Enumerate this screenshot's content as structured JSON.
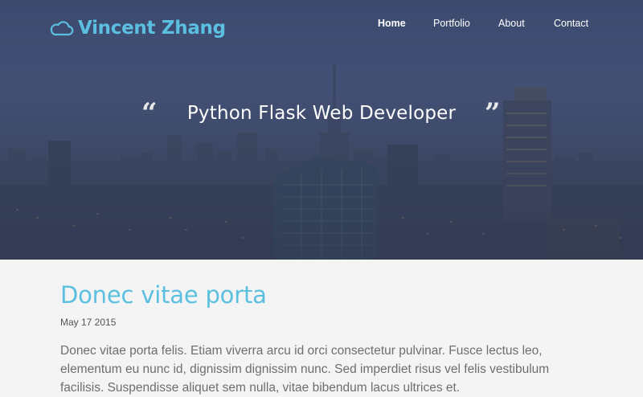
{
  "brand": {
    "name": "Vincent Zhang",
    "icon": "cloud-icon",
    "color": "#5bc0e0"
  },
  "nav": {
    "items": [
      {
        "label": "Home",
        "active": true
      },
      {
        "label": "Portfolio",
        "active": false
      },
      {
        "label": "About",
        "active": false
      },
      {
        "label": "Contact",
        "active": false
      }
    ]
  },
  "hero": {
    "tagline": "Python Flask Web Developer",
    "open_quote": "“",
    "close_quote": "”"
  },
  "post": {
    "title": "Donec vitae porta",
    "date": "May 17 2015",
    "body": "Donec vitae porta felis. Etiam viverra arcu id orci consectetur pulvinar. Fusce lectus leo, elementum eu nunc id, dignissim dignissim nunc. Sed imperdiet risus vel felis vestibulum facilisis. Suspendisse aliquet sem nulla, vitae bibendum lacus ultrices et."
  }
}
